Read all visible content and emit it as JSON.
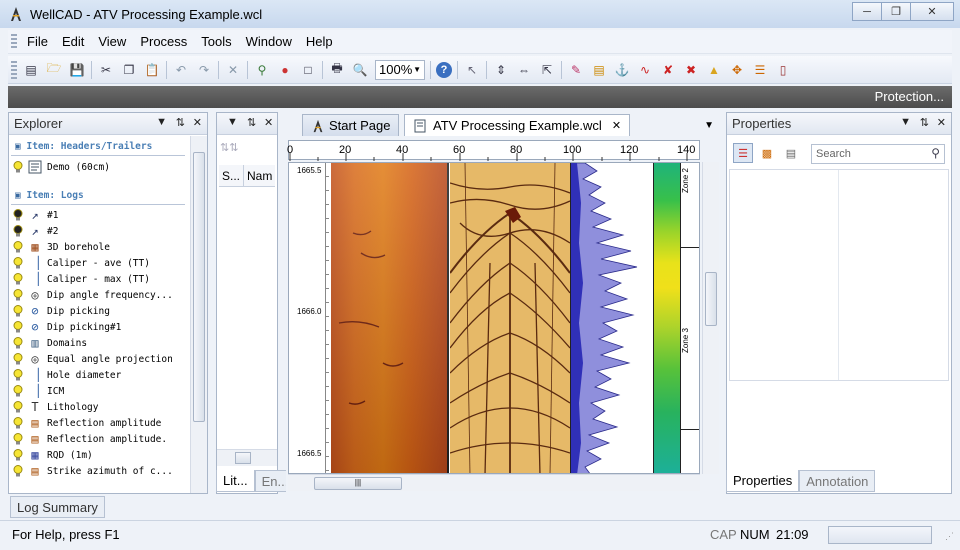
{
  "window": {
    "title": "WellCAD - ATV Processing Example.wcl"
  },
  "menu": [
    "File",
    "Edit",
    "View",
    "Process",
    "Tools",
    "Window",
    "Help"
  ],
  "toolbar": {
    "zoom": "100%"
  },
  "protection_label": "Protection...",
  "explorer": {
    "title": "Explorer",
    "section_headers": "Item: Headers/Trailers",
    "header_items": [
      "Demo (60cm)"
    ],
    "section_logs": "Item: Logs",
    "logs": [
      "#1",
      "#2",
      "3D borehole",
      "Caliper - ave (TT)",
      "Caliper - max (TT)",
      "Dip angle frequency...",
      "Dip picking",
      "Dip picking#1",
      "Domains",
      "Equal angle projection",
      "Hole diameter",
      "ICM",
      "Lithology",
      "Reflection amplitude",
      "Reflection amplitude.",
      "RQD (1m)",
      "Strike azimuth of c..."
    ],
    "tab_label": "Log Summary"
  },
  "mid_panel": {
    "columns": [
      "S...",
      "Nam"
    ],
    "tabs": [
      "Lit...",
      "En..."
    ]
  },
  "doc": {
    "tabs": [
      "Start Page",
      "ATV Processing Example.wcl"
    ],
    "ruler": [
      "0",
      "20",
      "40",
      "60",
      "80",
      "100",
      "120",
      "140"
    ],
    "depths": [
      "1665.5",
      "1666.0",
      "1666.5"
    ],
    "zones": [
      "Zone 2",
      "Zone 3"
    ]
  },
  "properties": {
    "title": "Properties",
    "search_placeholder": "Search",
    "tabs": [
      "Properties",
      "Annotation"
    ]
  },
  "status": {
    "help": "For Help, press F1",
    "cap": "CAP",
    "num": "NUM",
    "time": "21:09"
  }
}
